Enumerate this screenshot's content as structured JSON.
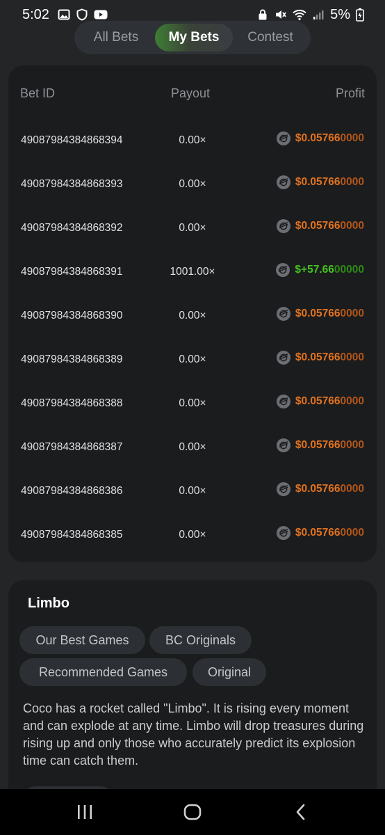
{
  "status_bar": {
    "time": "5:02",
    "battery": "5%",
    "left_icons": [
      "image-icon",
      "shield-icon",
      "youtube-icon"
    ],
    "right_icons": [
      "lock-icon",
      "mute-icon",
      "wifi-icon",
      "signal-icon",
      "battery-icon"
    ]
  },
  "tabs": [
    {
      "label": "All Bets",
      "active": false
    },
    {
      "label": "My Bets",
      "active": true
    },
    {
      "label": "Contest",
      "active": false
    }
  ],
  "bets_table": {
    "headers": {
      "bet_id": "Bet ID",
      "payout": "Payout",
      "profit": "Profit"
    },
    "rows": [
      {
        "id": "49087984384868394",
        "payout": "0.00×",
        "profit_main": "$0.05766",
        "profit_tail": "0000",
        "win": false
      },
      {
        "id": "49087984384868393",
        "payout": "0.00×",
        "profit_main": "$0.05766",
        "profit_tail": "0000",
        "win": false
      },
      {
        "id": "49087984384868392",
        "payout": "0.00×",
        "profit_main": "$0.05766",
        "profit_tail": "0000",
        "win": false
      },
      {
        "id": "49087984384868391",
        "payout": "1001.00×",
        "profit_main": "$+57.66",
        "profit_tail": "00000",
        "win": true
      },
      {
        "id": "49087984384868390",
        "payout": "0.00×",
        "profit_main": "$0.05766",
        "profit_tail": "0000",
        "win": false
      },
      {
        "id": "49087984384868389",
        "payout": "0.00×",
        "profit_main": "$0.05766",
        "profit_tail": "0000",
        "win": false
      },
      {
        "id": "49087984384868388",
        "payout": "0.00×",
        "profit_main": "$0.05766",
        "profit_tail": "0000",
        "win": false
      },
      {
        "id": "49087984384868387",
        "payout": "0.00×",
        "profit_main": "$0.05766",
        "profit_tail": "0000",
        "win": false
      },
      {
        "id": "49087984384868386",
        "payout": "0.00×",
        "profit_main": "$0.05766",
        "profit_tail": "0000",
        "win": false
      },
      {
        "id": "49087984384868385",
        "payout": "0.00×",
        "profit_main": "$0.05766",
        "profit_tail": "0000",
        "win": false
      }
    ],
    "coin_icon": "stellar-coin-icon",
    "colors": {
      "loss": "#e3731e",
      "win": "#45c41e"
    }
  },
  "game": {
    "title": "Limbo",
    "tags": [
      "Our Best Games",
      "BC Originals",
      "Recommended Games",
      "Original"
    ],
    "description": "Coco has a rocket called \"Limbo\". It is rising every moment and can explode at any time. Limbo will drop treasures during rising up and only those who accurately predict its explosion time can catch them."
  },
  "nav_bar": {
    "icons": [
      "recent-apps-icon",
      "home-icon",
      "back-icon"
    ]
  }
}
